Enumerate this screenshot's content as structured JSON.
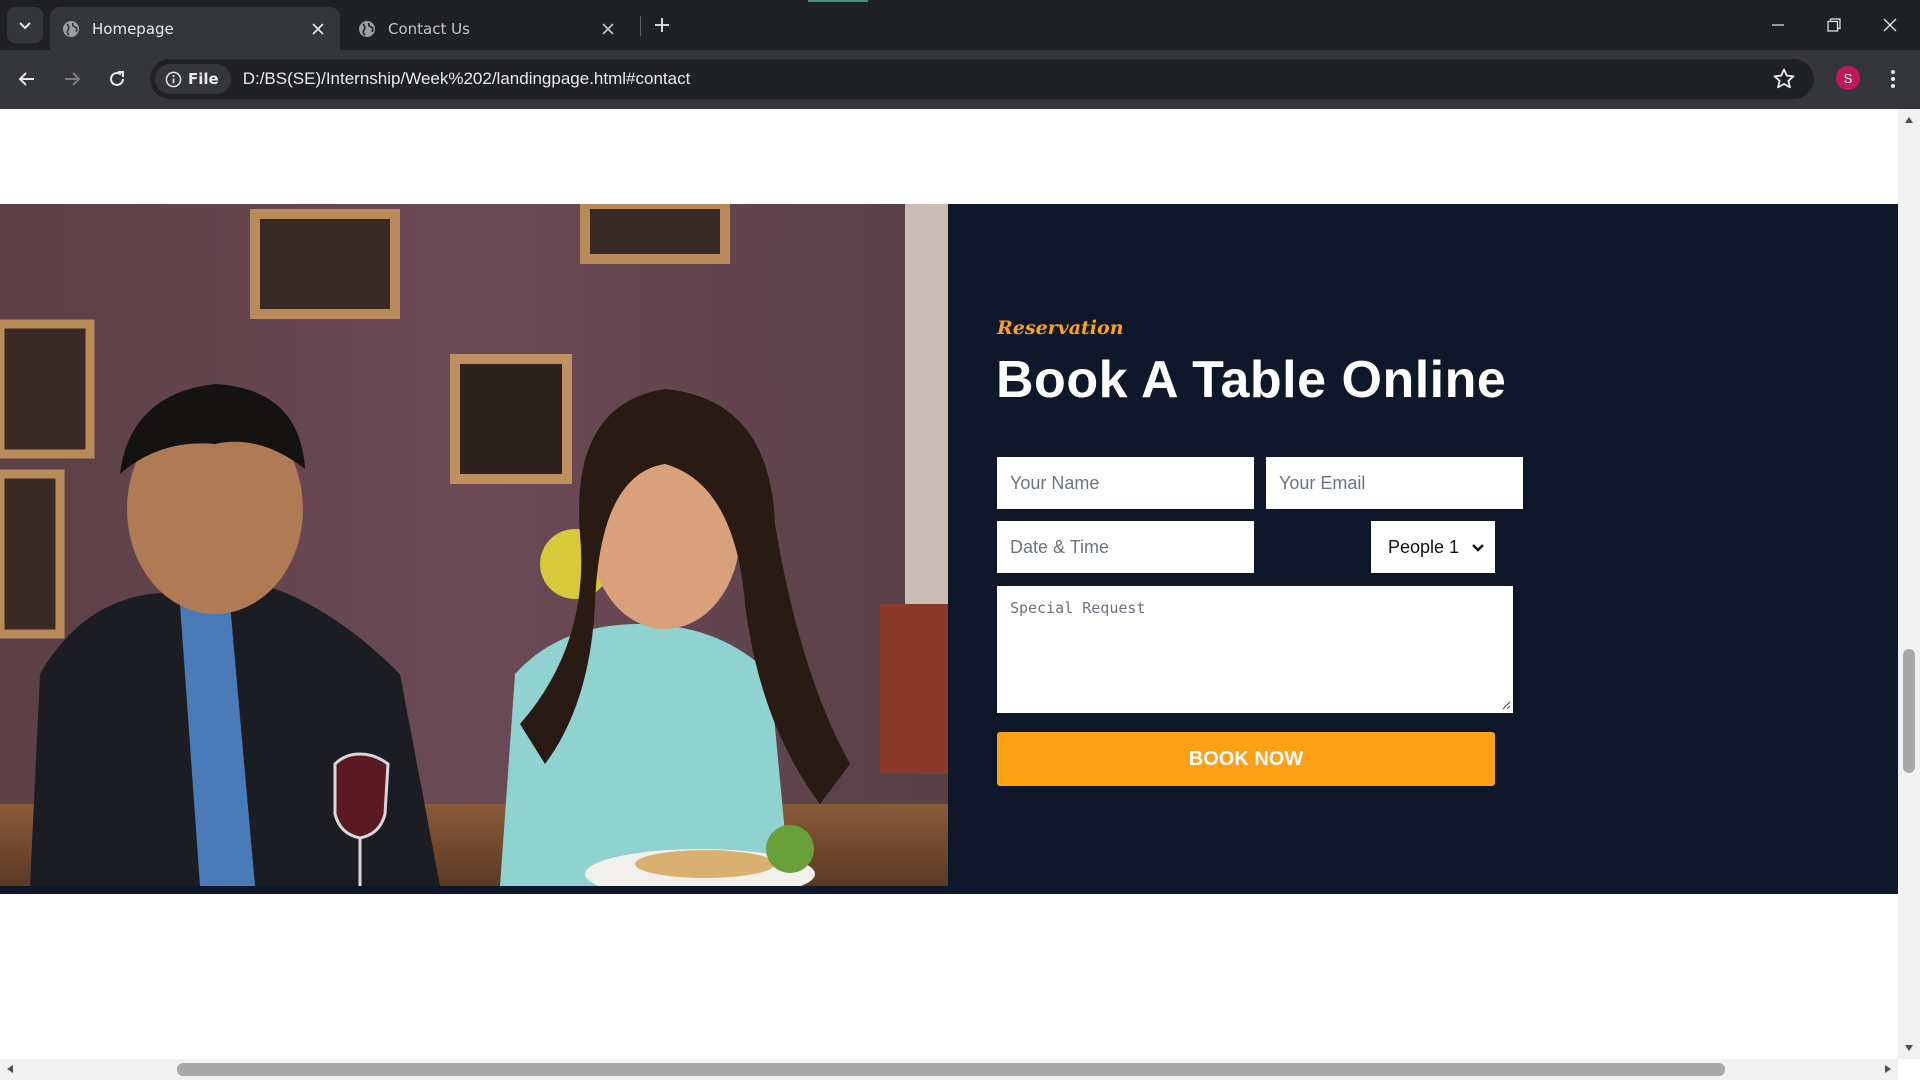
{
  "browser": {
    "tabs": [
      {
        "title": "Homepage",
        "active": true
      },
      {
        "title": "Contact Us",
        "active": false
      }
    ],
    "site_info_label": "File",
    "url": "D:/BS(SE)/Internship/Week%202/landingpage.html#contact",
    "profile_initial": "S"
  },
  "reservation": {
    "kicker": "Reservation",
    "heading": "Book A Table Online",
    "form": {
      "name_placeholder": "Your Name",
      "email_placeholder": "Your Email",
      "datetime_placeholder": "Date & Time",
      "people_selected": "People 1",
      "request_placeholder": "Special Request",
      "submit_label": "BOOK NOW"
    }
  },
  "colors": {
    "accent": "#fea116",
    "section_bg": "#0f172b",
    "chrome_dark": "#202124",
    "chrome_mid": "#35363a"
  },
  "icons": [
    "tab-search-icon",
    "globe-icon",
    "close-icon",
    "plus-icon",
    "minimize-icon",
    "restore-icon",
    "back-arrow-icon",
    "forward-arrow-icon",
    "reload-icon",
    "info-icon",
    "star-icon",
    "kebab-menu-icon",
    "chevron-down-icon"
  ]
}
